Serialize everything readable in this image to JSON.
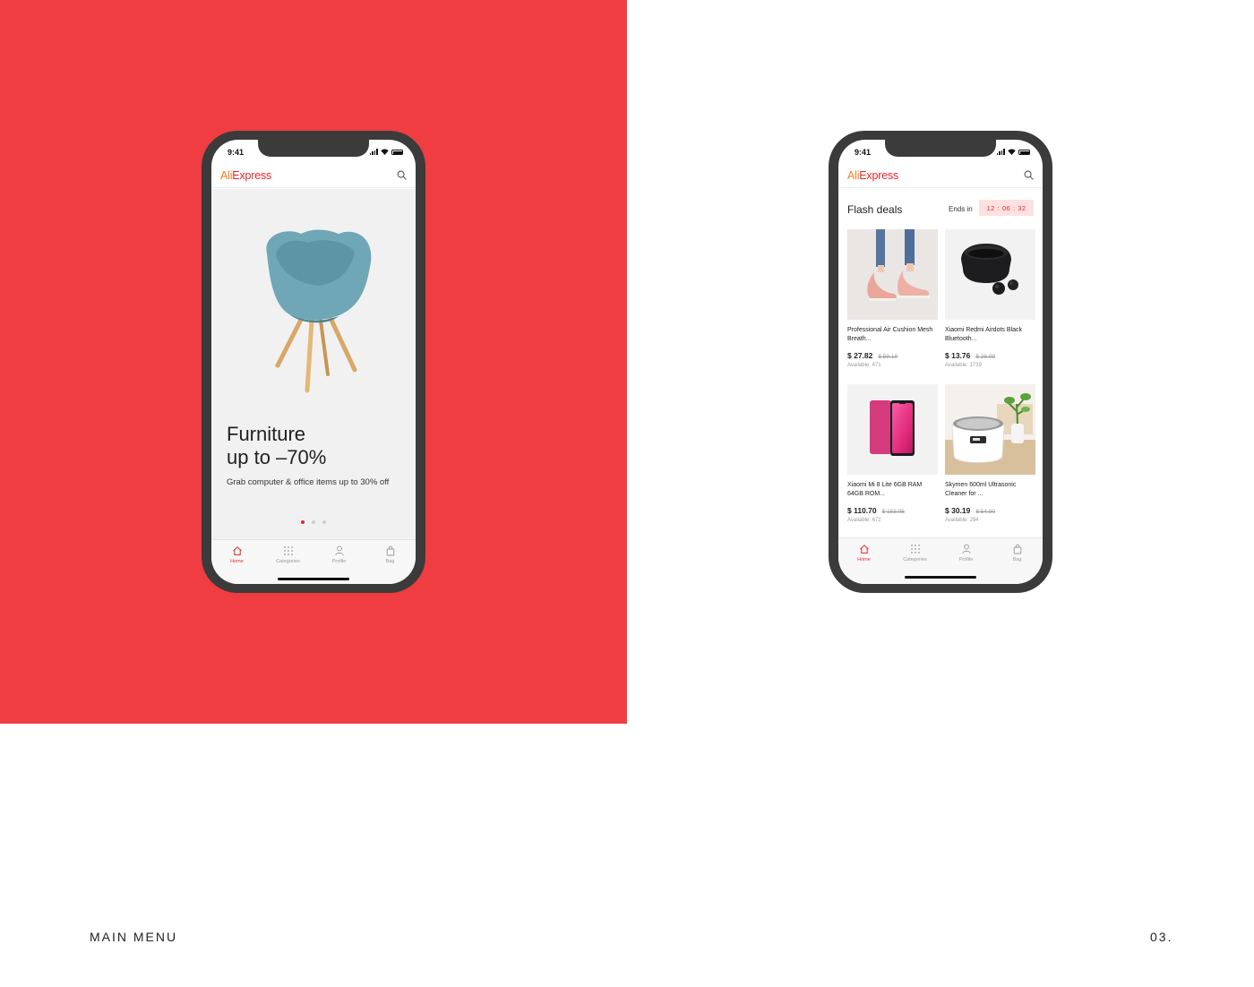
{
  "colors": {
    "brand_red": "#f03d41",
    "accent": "#e8262d",
    "logo_orange": "#f57c1f"
  },
  "footer": {
    "section_title": "MAIN MENU",
    "page_number": "03."
  },
  "left_phone": {
    "status_time": "9:41",
    "logo_part1": "Ali",
    "logo_part2": "Express",
    "banner": {
      "title_line1": "Furniture",
      "title_line2": "up to –70%",
      "subtitle": "Grab computer & office items up to 30% off",
      "carousel_dots": 3,
      "active_dot": 0
    },
    "tabs": [
      {
        "label": "Home",
        "icon": "home-icon",
        "active": true
      },
      {
        "label": "Categories",
        "icon": "grid-icon",
        "active": false
      },
      {
        "label": "Profile",
        "icon": "user-icon",
        "active": false
      },
      {
        "label": "Bag",
        "icon": "bag-icon",
        "active": false
      }
    ]
  },
  "right_phone": {
    "status_time": "9:41",
    "logo_part1": "Ali",
    "logo_part2": "Express",
    "section_title": "Flash deals",
    "ends_in_label": "Ends in",
    "timer": {
      "hours": "12",
      "minutes": "06",
      "seconds": "32"
    },
    "products": [
      {
        "name": "Professional Air Cushion Mesh Breath...",
        "price": "$ 27.82",
        "old_price": "$ 59.19",
        "available": "Available: 471",
        "image": "pink-sneakers"
      },
      {
        "name": "Xiaomi Redmi Airdots Black Bluetooth...",
        "price": "$ 13.76",
        "old_price": "$ 28.99",
        "available": "Available: 1739",
        "image": "black-earbuds"
      },
      {
        "name": "Xiaomi Mi 8 Lite 6GB RAM 64GB ROM...",
        "price": "$ 110.70",
        "old_price": "$ 153.05",
        "available": "Available: 672",
        "image": "pink-smartphone"
      },
      {
        "name": "Skymen 600ml Ultrasonic Cleaner for ...",
        "price": "$ 30.19",
        "old_price": "$ 54.90",
        "available": "Available: 294",
        "image": "ultrasonic-cleaner"
      }
    ],
    "tabs": [
      {
        "label": "Home",
        "icon": "home-icon",
        "active": true
      },
      {
        "label": "Categories",
        "icon": "grid-icon",
        "active": false
      },
      {
        "label": "Profile",
        "icon": "user-icon",
        "active": false
      },
      {
        "label": "Bag",
        "icon": "bag-icon",
        "active": false
      }
    ]
  }
}
